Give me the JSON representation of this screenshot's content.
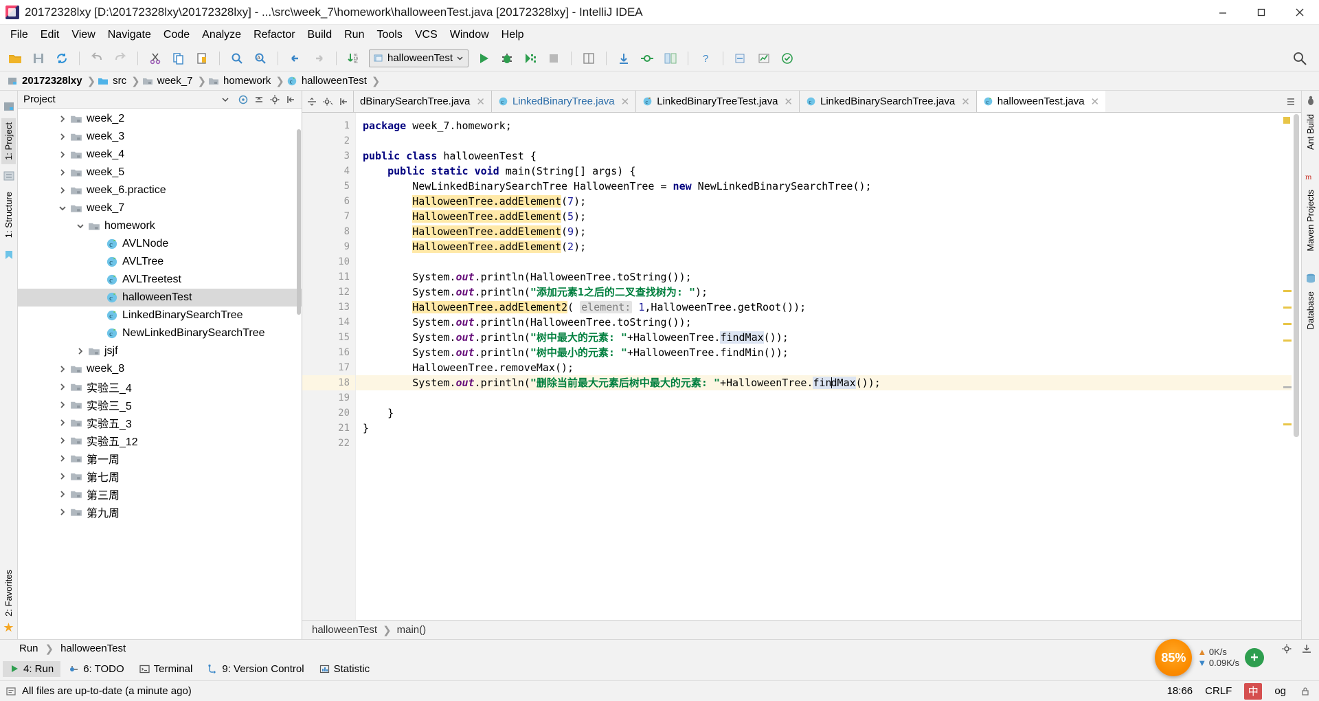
{
  "window": {
    "title": "20172328lxy [D:\\20172328lxy\\20172328lxy] - ...\\src\\week_7\\homework\\halloweenTest.java [20172328lxy] - IntelliJ IDEA",
    "minimize_label": "Minimize",
    "maximize_label": "Maximize",
    "close_label": "Close"
  },
  "menubar": [
    {
      "label": "File"
    },
    {
      "label": "Edit"
    },
    {
      "label": "View"
    },
    {
      "label": "Navigate"
    },
    {
      "label": "Code"
    },
    {
      "label": "Analyze"
    },
    {
      "label": "Refactor"
    },
    {
      "label": "Build"
    },
    {
      "label": "Run"
    },
    {
      "label": "Tools"
    },
    {
      "label": "VCS"
    },
    {
      "label": "Window"
    },
    {
      "label": "Help"
    }
  ],
  "toolbar": {
    "icons": [
      "open-folder-icon",
      "save-all-icon",
      "sync-icon",
      "undo-icon",
      "redo-icon",
      "cut-icon",
      "copy-icon",
      "paste-icon",
      "find-icon",
      "replace-icon",
      "back-icon",
      "forward-icon",
      "compile-icon"
    ],
    "run_config": "halloweenTest",
    "run_label": "Run",
    "debug_label": "Debug",
    "run_coverage_label": "Run with Coverage",
    "stop_label": "Stop",
    "right_icons": [
      "update-project-icon",
      "commit-icon",
      "diff-icon",
      "help-icon",
      "search-everywhere-icon"
    ]
  },
  "breadcrumb": [
    {
      "label": "20172328lxy",
      "icon": "module-icon"
    },
    {
      "label": "src",
      "icon": "source-folder-icon"
    },
    {
      "label": "week_7",
      "icon": "folder-icon"
    },
    {
      "label": "homework",
      "icon": "folder-icon"
    },
    {
      "label": "halloweenTest",
      "icon": "java-class-icon"
    }
  ],
  "left_strip": {
    "tabs": [
      {
        "label": "1: Project",
        "selected": true
      },
      {
        "label": "1: Structure",
        "selected": false
      }
    ],
    "bottom_tabs": [
      {
        "label": "2: Favorites",
        "selected": false
      }
    ]
  },
  "right_strip": {
    "tabs": [
      {
        "label": "Ant Build"
      },
      {
        "label": "Maven Projects"
      },
      {
        "label": "Database"
      }
    ]
  },
  "project_panel": {
    "title": "Project",
    "header_icons": [
      "target-icon",
      "collapse-all-icon",
      "settings-gear-icon",
      "hide-icon"
    ],
    "tree": [
      {
        "label": "week_2",
        "indent": 1,
        "expanded": false,
        "icon": "folder-icon",
        "selected": false
      },
      {
        "label": "week_3",
        "indent": 1,
        "expanded": false,
        "icon": "folder-icon",
        "selected": false
      },
      {
        "label": "week_4",
        "indent": 1,
        "expanded": false,
        "icon": "folder-icon",
        "selected": false
      },
      {
        "label": "week_5",
        "indent": 1,
        "expanded": false,
        "icon": "folder-icon",
        "selected": false
      },
      {
        "label": "week_6.practice",
        "indent": 1,
        "expanded": false,
        "icon": "package-icon",
        "selected": false
      },
      {
        "label": "week_7",
        "indent": 1,
        "expanded": true,
        "icon": "folder-icon",
        "selected": false
      },
      {
        "label": "homework",
        "indent": 2,
        "expanded": true,
        "icon": "folder-icon",
        "selected": false
      },
      {
        "label": "AVLNode",
        "indent": 3,
        "expanded": null,
        "icon": "java-class-icon",
        "selected": false
      },
      {
        "label": "AVLTree",
        "indent": 3,
        "expanded": null,
        "icon": "java-class-icon",
        "selected": false
      },
      {
        "label": "AVLTreetest",
        "indent": 3,
        "expanded": null,
        "icon": "java-test-icon",
        "selected": false
      },
      {
        "label": "halloweenTest",
        "indent": 3,
        "expanded": null,
        "icon": "java-class-icon",
        "selected": true
      },
      {
        "label": "LinkedBinarySearchTree",
        "indent": 3,
        "expanded": null,
        "icon": "java-class-icon",
        "selected": false
      },
      {
        "label": "NewLinkedBinarySearchTree",
        "indent": 3,
        "expanded": null,
        "icon": "java-class-icon",
        "selected": false
      },
      {
        "label": "jsjf",
        "indent": 2,
        "expanded": false,
        "icon": "folder-icon",
        "selected": false
      },
      {
        "label": "week_8",
        "indent": 1,
        "expanded": false,
        "icon": "folder-icon",
        "selected": false
      },
      {
        "label": "实验三_4",
        "indent": 1,
        "expanded": false,
        "icon": "folder-icon",
        "selected": false
      },
      {
        "label": "实验三_5",
        "indent": 1,
        "expanded": false,
        "icon": "folder-icon",
        "selected": false
      },
      {
        "label": "实验五_3",
        "indent": 1,
        "expanded": false,
        "icon": "folder-icon",
        "selected": false
      },
      {
        "label": "实验五_12",
        "indent": 1,
        "expanded": false,
        "icon": "folder-icon",
        "selected": false
      },
      {
        "label": "第一周",
        "indent": 1,
        "expanded": false,
        "icon": "folder-icon",
        "selected": false
      },
      {
        "label": "第七周",
        "indent": 1,
        "expanded": false,
        "icon": "folder-icon",
        "selected": false
      },
      {
        "label": "第三周",
        "indent": 1,
        "expanded": false,
        "icon": "folder-icon",
        "selected": false
      },
      {
        "label": "第九周",
        "indent": 1,
        "expanded": false,
        "icon": "folder-icon",
        "selected": false
      }
    ]
  },
  "editor_tabs": [
    {
      "label": "dBinarySearchTree.java",
      "icon": "java-class-icon",
      "active": false,
      "blue": false,
      "clipped": true
    },
    {
      "label": "LinkedBinaryTree.java",
      "icon": "java-class-icon",
      "active": false,
      "blue": true,
      "clipped": false
    },
    {
      "label": "LinkedBinaryTreeTest.java",
      "icon": "java-test-icon",
      "active": false,
      "blue": false,
      "clipped": false
    },
    {
      "label": "LinkedBinarySearchTree.java",
      "icon": "java-class-icon",
      "active": false,
      "blue": false,
      "clipped": false
    },
    {
      "label": "halloweenTest.java",
      "icon": "java-class-icon",
      "active": true,
      "blue": false,
      "clipped": false
    }
  ],
  "editor": {
    "line_numbers": [
      1,
      2,
      3,
      4,
      5,
      6,
      7,
      8,
      9,
      10,
      11,
      12,
      13,
      14,
      15,
      16,
      17,
      18,
      19,
      20,
      21,
      22
    ],
    "lines": [
      {
        "n": 1,
        "text": "package week_7.homework;",
        "highlight": false,
        "run_marker": false
      },
      {
        "n": 2,
        "text": "",
        "highlight": false,
        "run_marker": false
      },
      {
        "n": 3,
        "text": "public class halloweenTest {",
        "highlight": false,
        "run_marker": true
      },
      {
        "n": 4,
        "text": "    public static void main(String[] args) {",
        "highlight": false,
        "run_marker": true
      },
      {
        "n": 5,
        "text": "        NewLinkedBinarySearchTree HalloweenTree = new NewLinkedBinarySearchTree();",
        "highlight": false,
        "run_marker": false
      },
      {
        "n": 6,
        "text": "        HalloweenTree.addElement(7);",
        "highlight": false,
        "run_marker": false
      },
      {
        "n": 7,
        "text": "        HalloweenTree.addElement(5);",
        "highlight": false,
        "run_marker": false
      },
      {
        "n": 8,
        "text": "        HalloweenTree.addElement(9);",
        "highlight": false,
        "run_marker": false
      },
      {
        "n": 9,
        "text": "        HalloweenTree.addElement(2);",
        "highlight": false,
        "run_marker": false
      },
      {
        "n": 10,
        "text": "",
        "highlight": false,
        "run_marker": false
      },
      {
        "n": 11,
        "text": "        System.out.println(HalloweenTree.toString());",
        "highlight": false,
        "run_marker": false
      },
      {
        "n": 12,
        "text": "        System.out.println(\"添加元素1之后的二叉查找树为: \");",
        "highlight": false,
        "run_marker": false
      },
      {
        "n": 13,
        "text": "        HalloweenTree.addElement2( element: 1,HalloweenTree.getRoot());",
        "highlight": false,
        "run_marker": false
      },
      {
        "n": 14,
        "text": "        System.out.println(HalloweenTree.toString());",
        "highlight": false,
        "run_marker": false
      },
      {
        "n": 15,
        "text": "        System.out.println(\"树中最大的元素: \"+HalloweenTree.findMax());",
        "highlight": false,
        "run_marker": false
      },
      {
        "n": 16,
        "text": "        System.out.println(\"树中最小的元素: \"+HalloweenTree.findMin());",
        "highlight": false,
        "run_marker": false
      },
      {
        "n": 17,
        "text": "        HalloweenTree.removeMax();",
        "highlight": false,
        "run_marker": false
      },
      {
        "n": 18,
        "text": "        System.out.println(\"删除当前最大元素后树中最大的元素: \"+HalloweenTree.findMax());",
        "highlight": true,
        "run_marker": false
      },
      {
        "n": 19,
        "text": "",
        "highlight": false,
        "run_marker": false
      },
      {
        "n": 20,
        "text": "    }",
        "highlight": false,
        "run_marker": false
      },
      {
        "n": 21,
        "text": "}",
        "highlight": false,
        "run_marker": false
      },
      {
        "n": 22,
        "text": "",
        "highlight": false,
        "run_marker": false
      }
    ],
    "parameter_hint": "element:",
    "breadcrumb_bottom": [
      "halloweenTest",
      "main()"
    ]
  },
  "bottom": {
    "run_tab_label": "Run",
    "run_config_name": "halloweenTest",
    "tool_buttons": [
      {
        "label": "4: Run",
        "num": "4",
        "icon": "run-icon",
        "selected": true
      },
      {
        "label": "6: TODO",
        "num": "6",
        "icon": "todo-icon",
        "selected": false
      },
      {
        "label": "Terminal",
        "num": "",
        "icon": "terminal-icon",
        "selected": false
      },
      {
        "label": "9: Version Control",
        "num": "9",
        "icon": "version-control-icon",
        "selected": false
      },
      {
        "label": "Statistic",
        "num": "",
        "icon": "statistic-icon",
        "selected": false
      }
    ]
  },
  "statusbar": {
    "message": "All files are up-to-date (a minute ago)",
    "caret_position": "18:66",
    "line_separator": "CRLF",
    "ime_label": "中",
    "encoding": "og",
    "cpu_percent": "85%",
    "net_up": "0K/s",
    "net_down": "0.09K/s",
    "plus_label": "+"
  },
  "colors": {
    "accent_blue": "#2a6ca8",
    "keyword": "#00007f",
    "string": "#007f3e",
    "field": "#660e7a",
    "highlight_line": "#fdf6e3",
    "usage_highlight": "#ffe9a8",
    "selection": "#dce4f2",
    "warning": "#e8c547",
    "run_green": "#2e9e4f",
    "cpu_orange": "#fb8c00"
  }
}
